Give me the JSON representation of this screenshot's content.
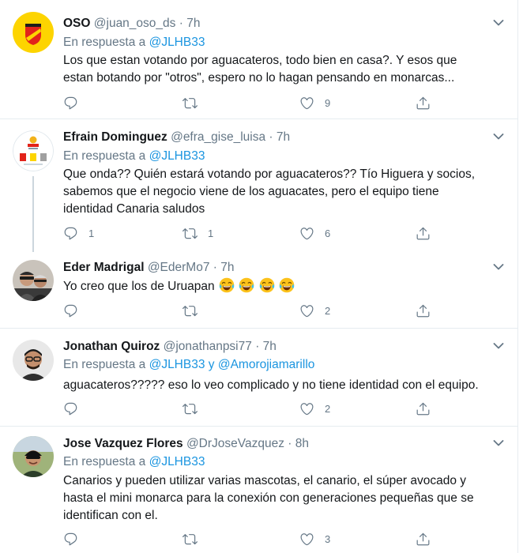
{
  "tweets": [
    {
      "name": "OSO",
      "handle": "@juan_oso_ds",
      "time": "· 7h",
      "reply_prefix": "En respuesta a",
      "reply_to": "@JLHB33",
      "text_lines": [
        "Los que estan votando por aguacateros, todo bien en casa?. Y esos que",
        "estan botando por \"otros\", espero no lo hagan pensando en monarcas..."
      ],
      "counts": {
        "replies": "",
        "retweets": "",
        "likes": "9"
      }
    },
    {
      "name": "Efrain Dominguez",
      "handle": "@efra_gise_luisa",
      "time": "· 7h",
      "reply_prefix": "En respuesta a",
      "reply_to": "@JLHB33",
      "text_lines": [
        "Que onda?? Quién estará votando por aguacateros?? Tío Higuera y socios,",
        "sabemos que el negocio viene de los aguacates, pero el equipo tiene",
        "identidad Canaria saludos"
      ],
      "counts": {
        "replies": "1",
        "retweets": "1",
        "likes": "6"
      }
    },
    {
      "name": "Eder Madrigal",
      "handle": "@EderMo7",
      "time": "· 7h",
      "text": "Yo creo que los de Uruapan",
      "emoji": [
        "😂",
        "😂",
        "😂",
        "😂"
      ],
      "counts": {
        "replies": "",
        "retweets": "",
        "likes": "2"
      }
    },
    {
      "name": "Jonathan Quiroz",
      "handle": "@jonathanpsi77",
      "time": "· 7h",
      "reply_prefix": "En respuesta a",
      "reply_to": "@JLHB33",
      "reply_joiner": "y",
      "reply_to_2": "@Amorojiamarillo",
      "text_lines": [
        "aguacateros????? eso lo veo complicado y no tiene identidad con el equipo."
      ],
      "counts": {
        "replies": "",
        "retweets": "",
        "likes": "2"
      }
    },
    {
      "name": "Jose Vazquez Flores",
      "handle": "@DrJoseVazquez",
      "time": "· 8h",
      "reply_prefix": "En respuesta a",
      "reply_to": "@JLHB33",
      "text_lines": [
        "Canarios y pueden utilizar varias mascotas, el canario, el súper avocado y",
        "hasta el mini monarca para la conexión con generaciones pequeñas que se",
        "identifican con el."
      ],
      "counts": {
        "replies": "",
        "retweets": "",
        "likes": "3"
      }
    }
  ],
  "colors": {
    "text": "#14171a",
    "muted": "#657786",
    "link": "#1b95e0",
    "border": "#e6ecf0",
    "thread": "#ccd6dd"
  },
  "icons": [
    "reply-icon",
    "retweet-icon",
    "like-icon",
    "share-icon",
    "chevron-down-icon",
    "tears-of-joy-emoji"
  ]
}
